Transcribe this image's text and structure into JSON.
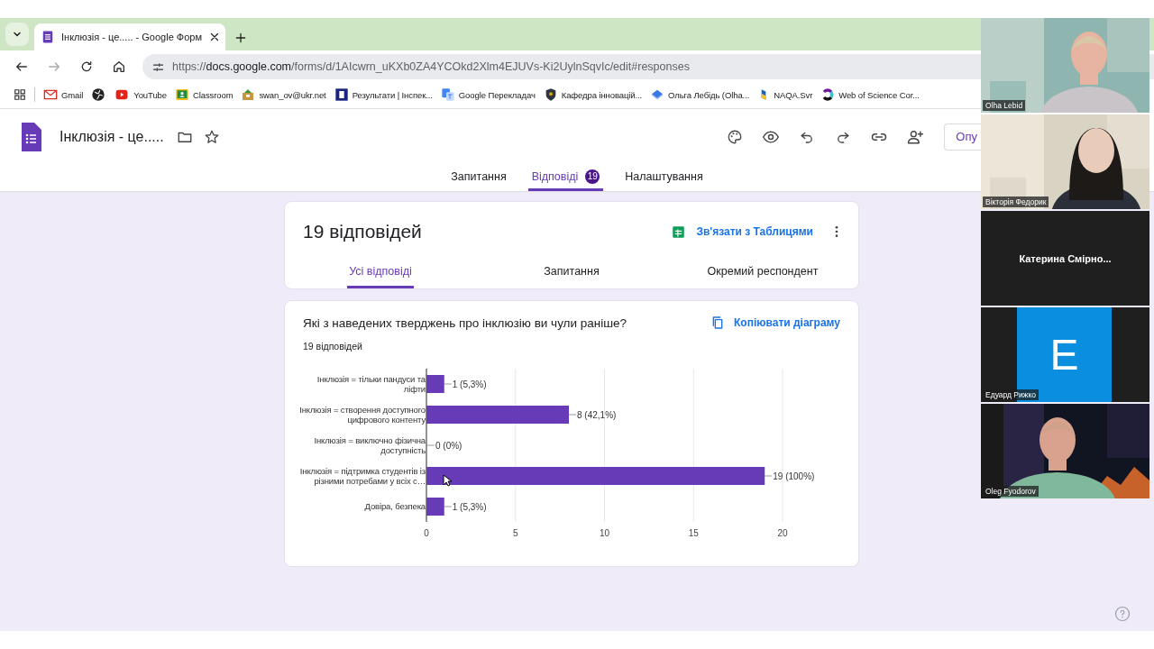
{
  "browser": {
    "tabs": [
      {
        "title": "Інклюзія - це..... - Google Форм",
        "selected": true
      }
    ],
    "address": {
      "scheme": "https://",
      "host": "docs.google.com",
      "path": "/forms/d/1AIcwrn_uKXb0ZA4YCOkd2Xlm4EJUVs-Ki2UylnSqvIc/edit#responses"
    },
    "bookmarks": [
      {
        "kind": "link",
        "label": "Gmail"
      },
      {
        "kind": "icon"
      },
      {
        "kind": "link",
        "label": "YouTube"
      },
      {
        "kind": "link",
        "label": "Classroom"
      },
      {
        "kind": "link",
        "label": "swan_ov@ukr.net"
      },
      {
        "kind": "link",
        "label": "Результати | Інспек..."
      },
      {
        "kind": "link",
        "label": "Google Перекладач"
      },
      {
        "kind": "link",
        "label": "Кафедра інновацій..."
      },
      {
        "kind": "link",
        "label": "Ольга Лебідь (Olha..."
      },
      {
        "kind": "link",
        "label": "NAQA.Svr"
      },
      {
        "kind": "link",
        "label": "Web of Science Cor..."
      }
    ]
  },
  "form": {
    "title": "Інклюзія - це.....",
    "publish_button": "Опу",
    "tabs": [
      {
        "label": "Запитання",
        "selected": false
      },
      {
        "label": "Відповіді",
        "selected": true,
        "badge": "19"
      },
      {
        "label": "Налаштування",
        "selected": false
      }
    ]
  },
  "summary": {
    "count": "19 відповідей",
    "link_sheets": "Зв'язати з Таблицями",
    "tabs": [
      {
        "label": "Усі відповіді",
        "selected": true
      },
      {
        "label": "Запитання",
        "selected": false
      },
      {
        "label": "Окремий респондент",
        "selected": false
      }
    ]
  },
  "question": {
    "title": "Які з наведених тверджень про інклюзію ви чули раніше?",
    "responses": "19 відповідей",
    "copy_chart": "Копіювати діаграму",
    "chart_data": {
      "type": "bar",
      "orientation": "horizontal",
      "categories": [
        "Інклюзія = тільки пандуси та ліфти",
        "Інклюзія = створення доступного цифрового контенту",
        "Інклюзія = виключно фізична доступність",
        "Інклюзія = підтримка студентів із різними потребами у всіх с…",
        "Довіра, безпека"
      ],
      "series": [
        {
          "color": "#673ab7",
          "values": [
            1,
            8,
            0,
            19,
            1
          ]
        }
      ],
      "grid": true,
      "value_labels": [
        "1 (5,3%)",
        "8 (42,1%)",
        "0 (0%)",
        "19 (100%)",
        "1 (5,3%)"
      ],
      "xlim": [
        0,
        20
      ],
      "xticks": [
        0,
        5,
        10,
        15,
        20
      ]
    }
  },
  "participants": [
    {
      "kind": "video",
      "name": "Olha Lebid"
    },
    {
      "kind": "video",
      "name": "Вікторія Федорик"
    },
    {
      "kind": "name",
      "name": "Катерина  Смірно..."
    },
    {
      "kind": "avatar",
      "name": "Едуард Рижко",
      "initial": "E"
    },
    {
      "kind": "video",
      "name": "Oleg Fyodorov"
    }
  ]
}
